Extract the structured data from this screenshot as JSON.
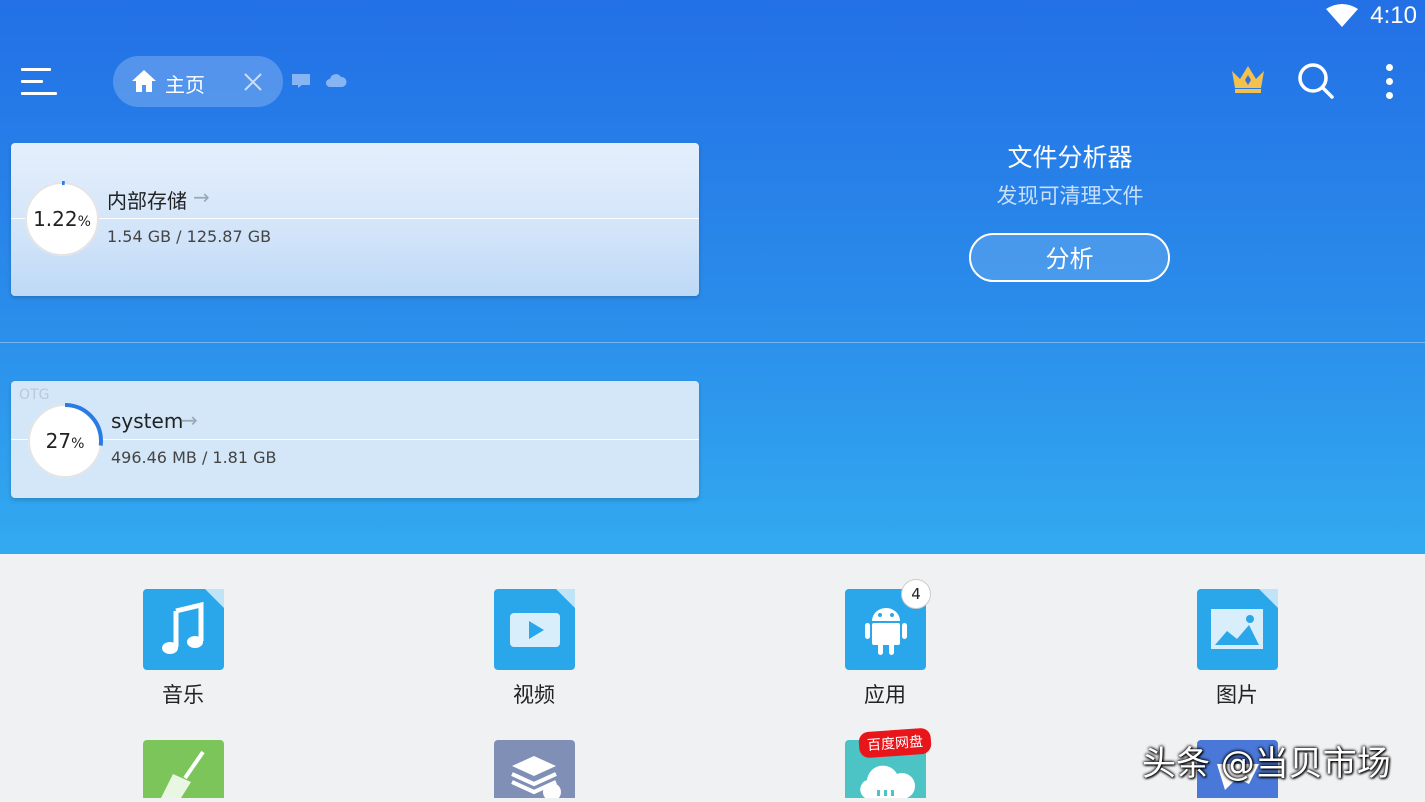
{
  "status": {
    "time": "4:10"
  },
  "toolbar": {
    "tab_label": "主页"
  },
  "storage": [
    {
      "percent": "1.22",
      "unit": "%",
      "name": "内部存储",
      "size": "1.54 GB / 125.87 GB",
      "used_fraction": 0.0122
    },
    {
      "tag": "OTG",
      "percent": "27",
      "unit": "%",
      "name": "system",
      "size": "496.46 MB / 1.81 GB",
      "used_fraction": 0.27
    }
  ],
  "analyzer": {
    "title": "文件分析器",
    "subtitle": "发现可清理文件",
    "button": "分析"
  },
  "categories": [
    {
      "label": "音乐",
      "icon": "music-icon",
      "color": "#2aa7ea"
    },
    {
      "label": "视频",
      "icon": "video-icon",
      "color": "#2aa7ea"
    },
    {
      "label": "应用",
      "icon": "android-icon",
      "color": "#2aa7ea",
      "badge": "4"
    },
    {
      "label": "图片",
      "icon": "image-icon",
      "color": "#2aa7ea"
    }
  ],
  "row2": [
    {
      "icon": "cleaner-icon",
      "color": "#7bc55a"
    },
    {
      "icon": "archive-icon",
      "color": "#7f8fb5"
    },
    {
      "icon": "cloud-icon",
      "color": "#4cc3c5",
      "badge": "百度网盘"
    },
    {
      "icon": "downloads-icon",
      "color": "#4a78d8"
    }
  ],
  "watermark": "头条 @当贝市场"
}
